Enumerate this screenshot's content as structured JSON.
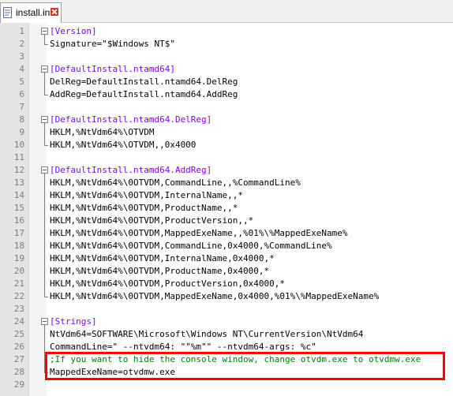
{
  "tab": {
    "label": "install.inf"
  },
  "lines": [
    {
      "n": "1",
      "text": "[Version]",
      "kind": "sec"
    },
    {
      "n": "2",
      "text": "Signature=\"$Windows NT$\"",
      "kind": "txt"
    },
    {
      "n": "3",
      "text": "",
      "kind": "txt"
    },
    {
      "n": "4",
      "text": "[DefaultInstall.ntamd64]",
      "kind": "sec"
    },
    {
      "n": "5",
      "text": "DelReg=DefaultInstall.ntamd64.DelReg",
      "kind": "txt"
    },
    {
      "n": "6",
      "text": "AddReg=DefaultInstall.ntamd64.AddReg",
      "kind": "txt"
    },
    {
      "n": "7",
      "text": "",
      "kind": "txt"
    },
    {
      "n": "8",
      "text": "[DefaultInstall.ntamd64.DelReg]",
      "kind": "sec"
    },
    {
      "n": "9",
      "text": "HKLM,%NtVdm64%\\OTVDM",
      "kind": "txt"
    },
    {
      "n": "10",
      "text": "HKLM,%NtVdm64%\\OTVDM,,0x4000",
      "kind": "txt"
    },
    {
      "n": "11",
      "text": "",
      "kind": "txt"
    },
    {
      "n": "12",
      "text": "[DefaultInstall.ntamd64.AddReg]",
      "kind": "sec"
    },
    {
      "n": "13",
      "text": "HKLM,%NtVdm64%\\0OTVDM,CommandLine,,%CommandLine%",
      "kind": "txt"
    },
    {
      "n": "14",
      "text": "HKLM,%NtVdm64%\\0OTVDM,InternalName,,*",
      "kind": "txt"
    },
    {
      "n": "15",
      "text": "HKLM,%NtVdm64%\\0OTVDM,ProductName,,*",
      "kind": "txt"
    },
    {
      "n": "16",
      "text": "HKLM,%NtVdm64%\\0OTVDM,ProductVersion,,*",
      "kind": "txt"
    },
    {
      "n": "17",
      "text": "HKLM,%NtVdm64%\\0OTVDM,MappedExeName,,%01%\\%MappedExeName%",
      "kind": "txt"
    },
    {
      "n": "18",
      "text": "HKLM,%NtVdm64%\\0OTVDM,CommandLine,0x4000,%CommandLine%",
      "kind": "txt"
    },
    {
      "n": "19",
      "text": "HKLM,%NtVdm64%\\0OTVDM,InternalName,0x4000,*",
      "kind": "txt"
    },
    {
      "n": "20",
      "text": "HKLM,%NtVdm64%\\0OTVDM,ProductName,0x4000,*",
      "kind": "txt"
    },
    {
      "n": "21",
      "text": "HKLM,%NtVdm64%\\0OTVDM,ProductVersion,0x4000,*",
      "kind": "txt"
    },
    {
      "n": "22",
      "text": "HKLM,%NtVdm64%\\0OTVDM,MappedExeName,0x4000,%01%\\%MappedExeName%",
      "kind": "txt"
    },
    {
      "n": "23",
      "text": "",
      "kind": "txt"
    },
    {
      "n": "24",
      "text": "[Strings]",
      "kind": "sec"
    },
    {
      "n": "25",
      "text": "NtVdm64=SOFTWARE\\Microsoft\\Windows NT\\CurrentVersion\\NtVdm64",
      "kind": "txt"
    },
    {
      "n": "26",
      "text": "CommandLine=\" --ntvdm64: \"\"%m\"\" --ntvdm64-args: %c\"",
      "kind": "txt"
    },
    {
      "n": "27",
      "text": ";If you want to hide the console window, change otvdm.exe to otvdmw.exe",
      "kind": "cmt"
    },
    {
      "n": "28",
      "text": "MappedExeName=otvdmw.exe",
      "kind": "txt"
    },
    {
      "n": "29",
      "text": "",
      "kind": "txt"
    }
  ],
  "colors": {
    "section": "#8000ff",
    "comment": "#008000",
    "text": "#000000",
    "highlight": "#ff0000"
  }
}
